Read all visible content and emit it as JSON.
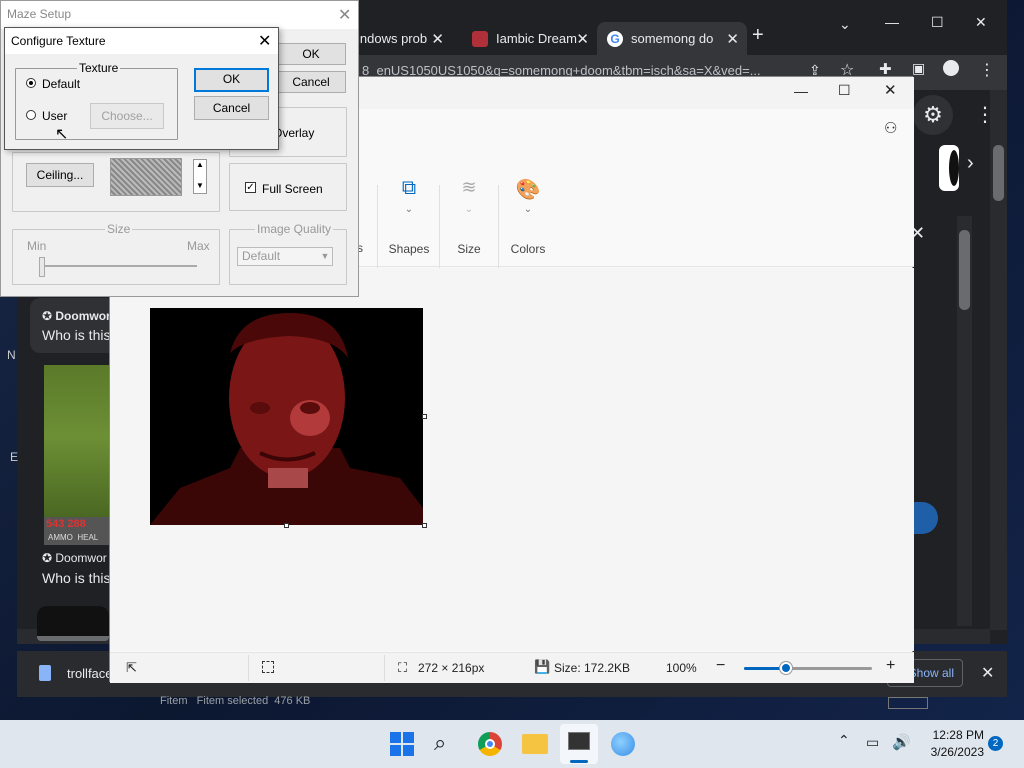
{
  "chrome": {
    "tabs": [
      {
        "label": "indows prob"
      },
      {
        "label": "Iambic Dream"
      },
      {
        "label": "somemong do"
      }
    ],
    "url": "8_enUS1050US1050&q=somemong+doom&tbm=isch&sa=X&ved=...",
    "page": {
      "card_source": "Doomwor",
      "card_question": "Who is this",
      "card2_source": "Doomwor",
      "card2_question": "Who is this",
      "hud_numbers": "543 288",
      "hud_labels": "AMMO  HEAL",
      "letter_n": "N",
      "letter_e": "E"
    },
    "download": {
      "filename": "trollface",
      "show_all": "Show all",
      "shelf_text": "Fitem   Fitem selected  476 KB"
    }
  },
  "paint": {
    "ribbon": {
      "partial_label": "s",
      "shapes": "Shapes",
      "size": "Size",
      "colors": "Colors"
    },
    "status": {
      "dimensions": "272 × 216px",
      "size": "Size: 172.2KB",
      "zoom": "100%"
    },
    "zoom_level": 0.33
  },
  "maze_setup": {
    "title": "Maze Setup",
    "ok": "OK",
    "cancel": "Cancel",
    "overlay": "e Overlay",
    "ceiling": "Ceiling...",
    "full_screen": "Full Screen",
    "size_group": "Size",
    "size_min": "Min",
    "size_max": "Max",
    "quality_group": "Image Quality",
    "quality_value": "Default"
  },
  "configure_texture": {
    "title": "Configure Texture",
    "group": "Texture",
    "default_option": "Default",
    "user_option": "User",
    "choose": "Choose...",
    "ok": "OK",
    "cancel": "Cancel"
  },
  "taskbar": {
    "time": "12:28 PM",
    "date": "3/26/2023",
    "notifications": "2"
  },
  "colors": {
    "chrome_bg": "#202124",
    "paint_bg": "#f9f9f9",
    "accent": "#0067c0",
    "selected_radio": "#000000"
  }
}
